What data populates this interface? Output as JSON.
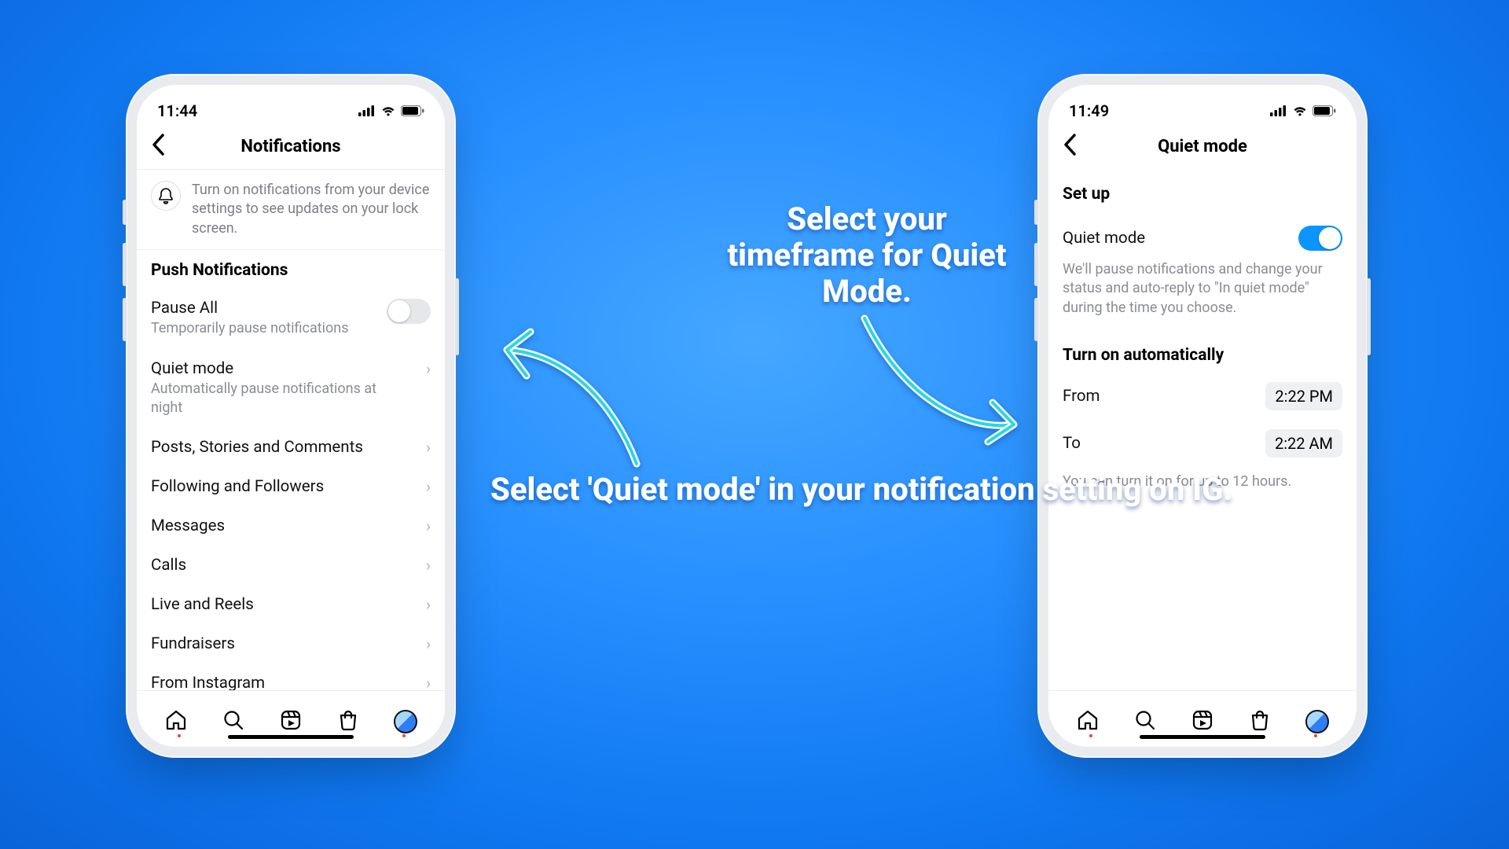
{
  "caption_left": "Select 'Quiet mode' in your notification setting on IG.",
  "caption_right": "Select your timeframe for Quiet Mode.",
  "phone_left": {
    "time": "11:44",
    "title": "Notifications",
    "banner": "Turn on notifications from your device settings to see updates on your lock screen.",
    "section_header": "Push Notifications",
    "pause_all": {
      "label": "Pause All",
      "sub": "Temporarily pause notifications",
      "on": false
    },
    "quiet": {
      "label": "Quiet mode",
      "sub": "Automatically pause notifications at night"
    },
    "items": [
      "Posts, Stories and Comments",
      "Following and Followers",
      "Messages",
      "Calls",
      "Live and Reels",
      "Fundraisers",
      "From Instagram"
    ]
  },
  "phone_right": {
    "time": "11:49",
    "title": "Quiet mode",
    "setup_header": "Set up",
    "quiet_label": "Quiet mode",
    "quiet_on": true,
    "quiet_desc": "We'll pause notifications and change your status and auto-reply to \"In quiet mode\" during the time you choose.",
    "auto_header": "Turn on automatically",
    "from_label": "From",
    "from_value": "2:22 PM",
    "to_label": "To",
    "to_value": "2:22 AM",
    "hint": "You can turn it on for up to 12 hours."
  }
}
